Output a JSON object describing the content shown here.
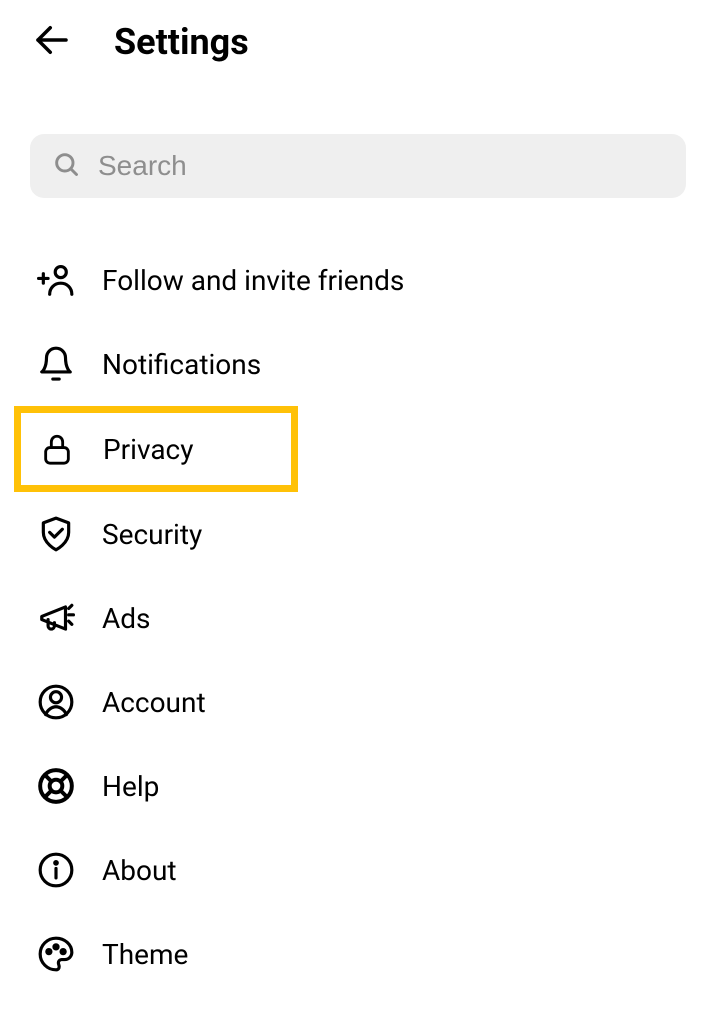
{
  "header": {
    "title": "Settings"
  },
  "search": {
    "placeholder": "Search"
  },
  "menu": {
    "items": [
      {
        "label": "Follow and invite friends",
        "icon": "add-user-icon",
        "highlighted": false
      },
      {
        "label": "Notifications",
        "icon": "bell-icon",
        "highlighted": false
      },
      {
        "label": "Privacy",
        "icon": "lock-icon",
        "highlighted": true
      },
      {
        "label": "Security",
        "icon": "shield-check-icon",
        "highlighted": false
      },
      {
        "label": "Ads",
        "icon": "megaphone-icon",
        "highlighted": false
      },
      {
        "label": "Account",
        "icon": "account-icon",
        "highlighted": false
      },
      {
        "label": "Help",
        "icon": "help-icon",
        "highlighted": false
      },
      {
        "label": "About",
        "icon": "info-icon",
        "highlighted": false
      },
      {
        "label": "Theme",
        "icon": "palette-icon",
        "highlighted": false
      }
    ]
  }
}
